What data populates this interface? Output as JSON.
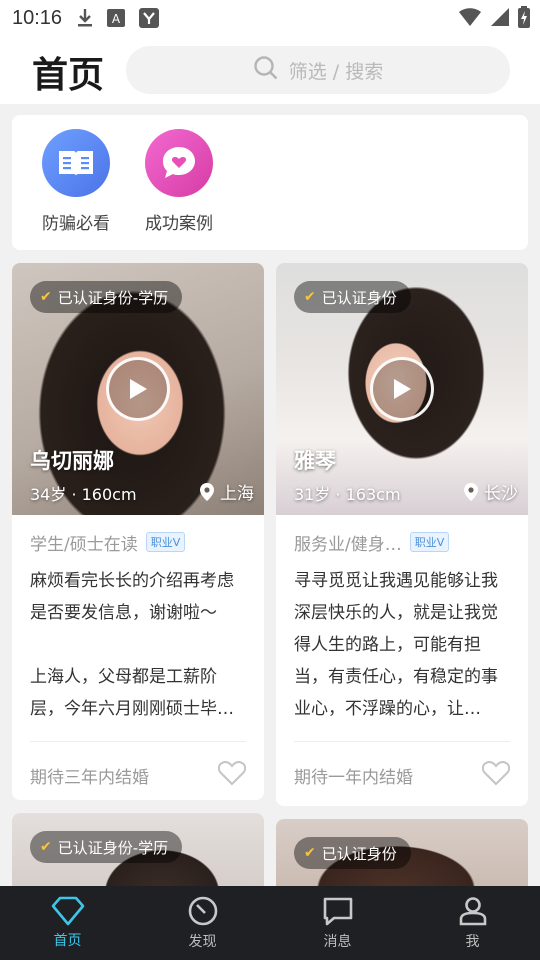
{
  "status_bar": {
    "time": "10:16"
  },
  "header": {
    "title": "首页",
    "search_placeholder": "筛选 / 搜索"
  },
  "quick_entries": [
    {
      "label": "防骗必看",
      "icon": "book-icon",
      "color": "#5b8cf7"
    },
    {
      "label": "成功案例",
      "icon": "heart-chat-icon",
      "color": "#e84fb8"
    }
  ],
  "cards": [
    {
      "badge": "已认证身份-学历",
      "name": "乌切丽娜",
      "info": "34岁 · 160cm",
      "location": "上海",
      "job": "学生/硕士在读",
      "vtag": "职业V",
      "intro": "麻烦看完长长的介绍再考虑是否要发信息，谢谢啦～\n\n上海人，父母都是工薪阶层，今年六月刚刚硕士毕…",
      "expect": "期待三年内结婚"
    },
    {
      "badge": "已认证身份",
      "name": "雅琴",
      "info": "31岁 · 163cm",
      "location": "长沙",
      "job": "服务业/健身…",
      "vtag": "职业V",
      "intro": "寻寻觅觅让我遇见能够让我深层快乐的人，就是让我觉得人生的路上，可能有担当，有责任心，有稳定的事业心，不浮躁的心，让…",
      "expect": "期待一年内结婚"
    },
    {
      "badge": "已认证身份-学历"
    },
    {
      "badge": "已认证身份"
    }
  ],
  "nav": [
    {
      "label": "首页",
      "icon": "diamond-icon",
      "active": true
    },
    {
      "label": "发现",
      "icon": "compass-icon",
      "active": false
    },
    {
      "label": "消息",
      "icon": "chat-icon",
      "active": false
    },
    {
      "label": "我",
      "icon": "user-icon",
      "active": false
    }
  ],
  "colors": {
    "accent": "#3cc6e8",
    "nav_bg": "#1f2024"
  }
}
